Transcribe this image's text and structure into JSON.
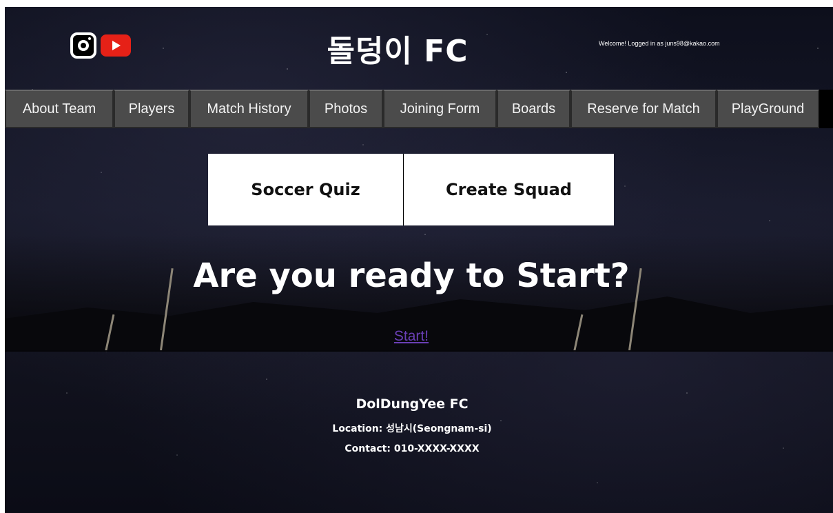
{
  "header": {
    "title": "돌덩이 FC",
    "welcome": "Welcome! Logged in as juns98@kakao.com",
    "social": [
      {
        "icon": "instagram-icon"
      },
      {
        "icon": "youtube-icon",
        "color": "#e62117"
      }
    ]
  },
  "nav": {
    "items": [
      {
        "label": "About Team"
      },
      {
        "label": "Players"
      },
      {
        "label": "Match History"
      },
      {
        "label": "Photos"
      },
      {
        "label": "Joining Form"
      },
      {
        "label": "Boards"
      },
      {
        "label": "Reserve for Match"
      },
      {
        "label": "PlayGround"
      }
    ]
  },
  "main": {
    "tabs": [
      {
        "label": "Soccer Quiz"
      },
      {
        "label": "Create Squad"
      }
    ],
    "headline": "Are you ready to Start?",
    "start_link": "Start!"
  },
  "footer": {
    "name": "DolDungYee FC",
    "location": "Location: 성남시(Seongnam-si)",
    "contact": "Contact: 010-XXXX-XXXX"
  },
  "colors": {
    "nav_bg": "#4b4b4b",
    "link": "#6a3fb6",
    "youtube": "#e62117"
  }
}
